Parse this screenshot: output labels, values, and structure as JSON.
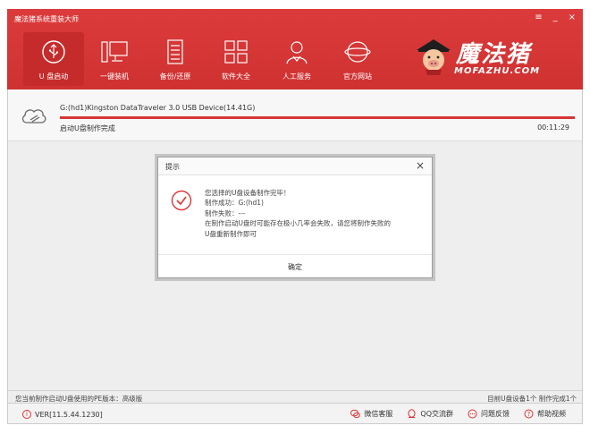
{
  "window": {
    "title": "魔法猪系统重装大师",
    "controls": [
      "≡",
      "_",
      "×"
    ]
  },
  "nav": {
    "items": [
      {
        "label": "U 盘启动",
        "icon": "usb-icon",
        "active": true
      },
      {
        "label": "一键装机",
        "icon": "computer-icon",
        "active": false
      },
      {
        "label": "备份/还原",
        "icon": "document-icon",
        "active": false
      },
      {
        "label": "软件大全",
        "icon": "grid-icon",
        "active": false
      },
      {
        "label": "人工服务",
        "icon": "person-icon",
        "active": false
      },
      {
        "label": "官方网站",
        "icon": "globe-icon",
        "active": false
      }
    ]
  },
  "brand": {
    "cn": "魔法猪",
    "en": "MOFAZHU.COM"
  },
  "device": {
    "name": "G:(hd1)Kingston DataTraveler 3.0 USB Device(14.41G)",
    "status": "启动U盘制作完成",
    "time": "00:11:29",
    "progress": 1.0
  },
  "dialog": {
    "title": "提示",
    "close": "×",
    "lines": [
      "您选择的U盘设备制作完毕！",
      "制作成功：G:(hd1)",
      "制作失败：---",
      "在制作启动U盘时可能存在极小几率会失败，请您将制作失败的",
      "U盘重新制作即可"
    ],
    "ok": "确定"
  },
  "info_bar": {
    "left": "您当前制作启动U盘使用的PE版本：高级版",
    "right": "目前U盘设备1个 制作完成1个"
  },
  "status_bar": {
    "version": "VER[11.5.44.1230]",
    "links": [
      {
        "label": "微信客服",
        "icon": "wechat-icon"
      },
      {
        "label": "QQ交流群",
        "icon": "qq-icon"
      },
      {
        "label": "问题反馈",
        "icon": "feedback-icon"
      },
      {
        "label": "帮助视频",
        "icon": "help-icon"
      }
    ]
  },
  "colors": {
    "accent": "#d93a3a",
    "progress": "#d73535"
  }
}
